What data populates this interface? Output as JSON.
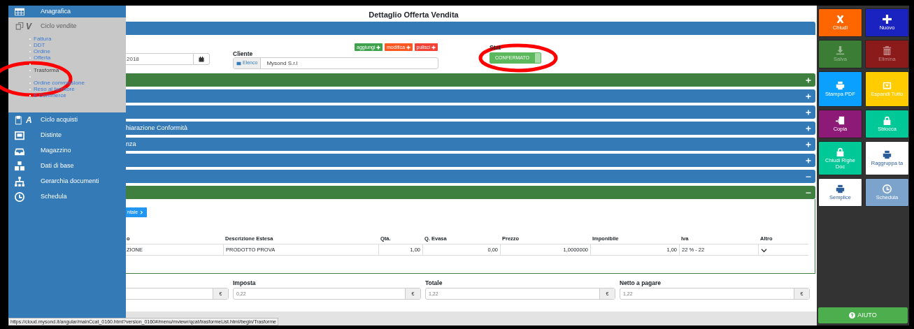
{
  "sidebar": {
    "items": [
      {
        "label": "Anagrafica",
        "expanded": false
      },
      {
        "label": "Ciclo vendite",
        "icon_letter": "V",
        "expanded": true,
        "children": [
          {
            "kind": "link",
            "label": "Fattura",
            "selected": false
          },
          {
            "kind": "link",
            "label": "DDT",
            "selected": false
          },
          {
            "kind": "link",
            "label": "Ordine",
            "selected": false
          },
          {
            "kind": "link",
            "label": "Offerta",
            "selected": false
          },
          {
            "kind": "blank"
          },
          {
            "kind": "link",
            "label": "Trasforma",
            "selected": true
          },
          {
            "kind": "blank"
          },
          {
            "kind": "link",
            "label": "Ordine commissione",
            "selected": false
          },
          {
            "kind": "link",
            "label": "Reso al fornitore",
            "selected": false
          },
          {
            "kind": "link",
            "label": "E Commerce",
            "selected": false
          }
        ]
      },
      {
        "label": "Ciclo acquisti",
        "icon_letter": "A",
        "expanded": false
      },
      {
        "label": "Distinte",
        "expanded": false
      },
      {
        "label": "Magazzino",
        "expanded": false
      },
      {
        "label": "Dati di base",
        "expanded": false
      },
      {
        "label": "Gerarchia documenti",
        "expanded": false
      },
      {
        "label": "Schedula",
        "expanded": false
      }
    ]
  },
  "page": {
    "title": "Dettaglio Offerta Vendita"
  },
  "form": {
    "date_value": "2018",
    "cliente_label": "Cliente",
    "cliente_addon": "Elenco",
    "cliente_value": "Mysond S.r.l",
    "cliente_actions": [
      {
        "label": "aggiungi",
        "color": "#3fa34d"
      },
      {
        "label": "modifica",
        "color": "#ff5722"
      },
      {
        "label": "pulisci",
        "color": "#f44336"
      }
    ],
    "stato_label": "Stat",
    "stato_toggle": {
      "label": "CONFERMATO",
      "on": true
    }
  },
  "sections": [
    {
      "color": "#3f7f3f",
      "expanded": false
    },
    {
      "color": "#337ab7",
      "expanded": false
    },
    {
      "color": "#337ab7",
      "expanded": false
    },
    {
      "label": "hiarazione Conformità",
      "color": "#337ab7",
      "expanded": false
    },
    {
      "label": "nza",
      "color": "#337ab7",
      "expanded": false
    },
    {
      "color": "#337ab7",
      "expanded": false
    },
    {
      "color": "#337ab7",
      "expanded": true
    },
    {
      "color": "#3f7f3f",
      "expanded": true
    }
  ],
  "detail_button": "ntale",
  "table": {
    "columns": [
      "o",
      "Descrizione Estesa",
      "Qtà.",
      "Q. Evasa",
      "Prezzo",
      "Imponibile",
      "Iva",
      "Altro"
    ],
    "rows": [
      {
        "cells": [
          "ZIONE",
          "PRODOTTO PROVA",
          "1,00",
          "0,00",
          "1,0000000",
          "1,00",
          "22 % - 22"
        ]
      }
    ]
  },
  "totals": [
    {
      "addon": "€"
    },
    {
      "label": "Imposta",
      "value": "0,22",
      "addon": "€"
    },
    {
      "label": "Totale",
      "value": "1,22",
      "addon": "€"
    },
    {
      "label": "Netto a pagare",
      "value": "1,22",
      "addon": "€"
    }
  ],
  "actions": [
    {
      "label": "Chiudi",
      "color": "#ff6600",
      "disabled": false
    },
    {
      "label": "Nuovo",
      "color": "#1a22c0",
      "disabled": false
    },
    {
      "label": "Salva",
      "color": "#3c7d35",
      "disabled": true
    },
    {
      "label": "Elimina",
      "color": "#8b1a1a",
      "disabled": true
    },
    {
      "label": "Stampa PDF",
      "color": "#0aa0ff",
      "disabled": false
    },
    {
      "label": "Espandi Tutto",
      "color": "#ffcc00",
      "disabled": false
    },
    {
      "label": "Copia",
      "color": "#8e1a78",
      "disabled": false
    },
    {
      "label": "Sblocca",
      "color": "#00c896",
      "disabled": false
    },
    {
      "label": "Chiudi Righe Doc",
      "color": "#00c896",
      "disabled": false
    },
    {
      "label": "Raggruppa ta",
      "color": "#ffffff",
      "disabled": false
    },
    {
      "label": "Semplice",
      "color": "#ffffff",
      "disabled": false
    },
    {
      "label": "Schedula",
      "color": "#7ba3cc",
      "disabled": false
    }
  ],
  "help_button": "AIUTO",
  "status_bar": "https://cloud.mysond.it/angular/mainCcat_0160.html?version_0160#/menu/mviewr/qcat/trasformeList.html/begin/Trasforme"
}
